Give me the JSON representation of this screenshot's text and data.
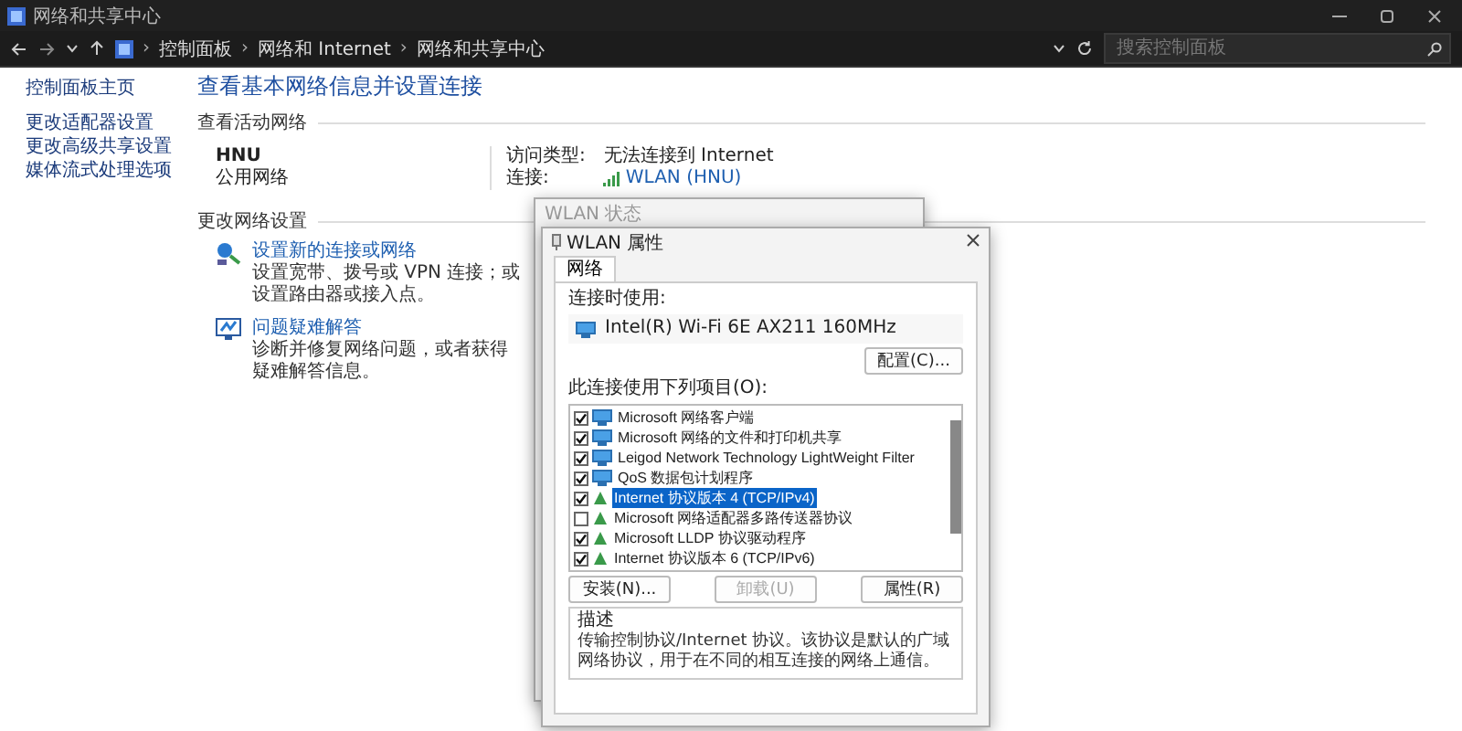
{
  "window": {
    "title": "网络和共享中心"
  },
  "address_bar": {
    "breadcrumbs": [
      "控制面板",
      "网络和 Internet",
      "网络和共享中心"
    ],
    "separator": "›"
  },
  "search": {
    "placeholder": "搜索控制面板"
  },
  "sidebar": {
    "items": [
      "控制面板主页",
      "更改适配器设置",
      "更改高级共享设置",
      "媒体流式处理选项"
    ]
  },
  "main": {
    "heading": "查看基本网络信息并设置连接",
    "active_networks": {
      "title": "查看活动网络",
      "name": "HNU",
      "type": "公用网络",
      "access_label": "访问类型:",
      "access_value": "无法连接到 Internet",
      "connection_label": "连接:",
      "connection_value": "WLAN (HNU)"
    },
    "change_settings": {
      "title": "更改网络设置",
      "tasks": [
        {
          "kind": "setup",
          "link": "设置新的连接或网络",
          "description": "设置宽带、拨号或 VPN 连接；或设置路由器或接入点。"
        },
        {
          "kind": "troubleshoot",
          "link": "问题疑难解答",
          "description": "诊断并修复网络问题，或者获得疑难解答信息。"
        }
      ]
    }
  },
  "status_dialog": {
    "title": "WLAN 状态"
  },
  "properties_dialog": {
    "title": "WLAN 属性",
    "tabs": [
      {
        "label": "网络",
        "selected": true
      }
    ],
    "connect_using_label": "连接时使用:",
    "adapter": "Intel(R) Wi-Fi 6E AX211 160MHz",
    "configure_button": "配置(C)...",
    "items_label": "此连接使用下列项目(O):",
    "items": [
      {
        "label": "Microsoft 网络客户端",
        "kind": "client",
        "checked": true,
        "selected": false
      },
      {
        "label": "Microsoft 网络的文件和打印机共享",
        "kind": "client",
        "checked": true,
        "selected": false
      },
      {
        "label": "Leigod Network Technology LightWeight Filter",
        "kind": "client",
        "checked": true,
        "selected": false
      },
      {
        "label": "QoS 数据包计划程序",
        "kind": "client",
        "checked": true,
        "selected": false
      },
      {
        "label": "Internet 协议版本 4 (TCP/IPv4)",
        "kind": "protocol",
        "checked": true,
        "selected": true
      },
      {
        "label": "Microsoft 网络适配器多路传送器协议",
        "kind": "protocol",
        "checked": false,
        "selected": false
      },
      {
        "label": "Microsoft LLDP 协议驱动程序",
        "kind": "protocol",
        "checked": true,
        "selected": false
      },
      {
        "label": "Internet 协议版本 6 (TCP/IPv6)",
        "kind": "protocol",
        "checked": true,
        "selected": false
      }
    ],
    "buttons": [
      {
        "label": "安装(N)...",
        "disabled": false
      },
      {
        "label": "卸载(U)",
        "disabled": true
      },
      {
        "label": "属性(R)",
        "disabled": false
      }
    ],
    "description_title": "描述",
    "description": "传输控制协议/Internet 协议。该协议是默认的广域网络协议，用于在不同的相互连接的网络上通信。"
  }
}
